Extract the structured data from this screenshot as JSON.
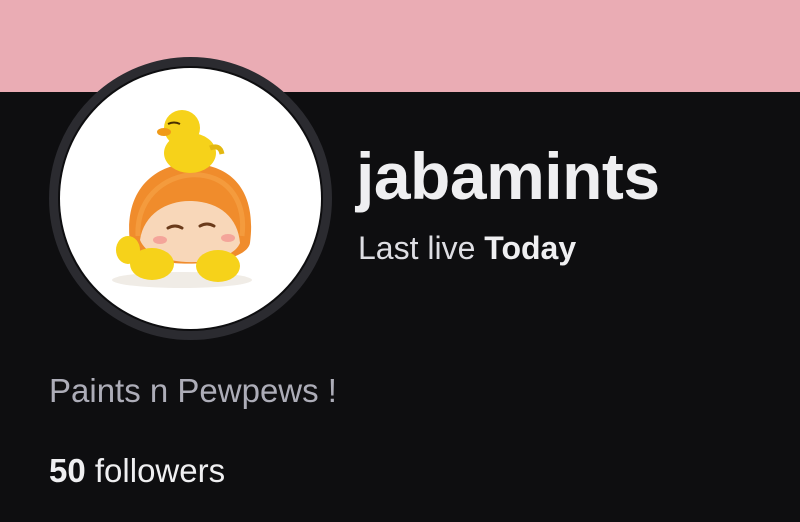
{
  "banner": {
    "color": "#eaacb4"
  },
  "profile": {
    "avatar": "waddle-dee-figure-with-yellow-bird",
    "username": "jabamints",
    "last_live_label": "Last live",
    "last_live_value": "Today",
    "bio": "Paints n Pewpews !",
    "followers_count": "50",
    "followers_label": "followers"
  }
}
